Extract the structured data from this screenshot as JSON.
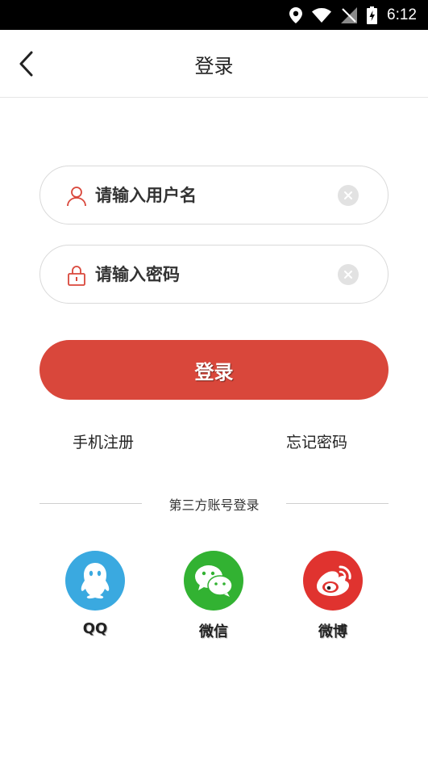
{
  "status_bar": {
    "time": "6:12",
    "icons": [
      "location-icon",
      "wifi-icon",
      "no-signal-icon",
      "battery-charging-icon"
    ]
  },
  "nav": {
    "back_icon": "chevron-left-icon",
    "title": "登录"
  },
  "form": {
    "username": {
      "placeholder": "请输入用户名",
      "value": "",
      "icon": "user-icon",
      "clear_icon": "clear-icon"
    },
    "password": {
      "placeholder": "请输入密码",
      "value": "",
      "icon": "lock-icon",
      "clear_icon": "clear-icon"
    },
    "submit_label": "登录"
  },
  "links": {
    "register": "手机注册",
    "forgot": "忘记密码"
  },
  "third_party": {
    "heading": "第三方账号登录",
    "providers": [
      {
        "label": "QQ",
        "icon": "qq-icon",
        "color": "#3aa9e0"
      },
      {
        "label": "微信",
        "icon": "wechat-icon",
        "color": "#32b232"
      },
      {
        "label": "微博",
        "icon": "weibo-icon",
        "color": "#e0332f"
      }
    ]
  },
  "colors": {
    "accent": "#d9473b",
    "status_bar": "#000000",
    "icon_red": "#d9473b"
  }
}
